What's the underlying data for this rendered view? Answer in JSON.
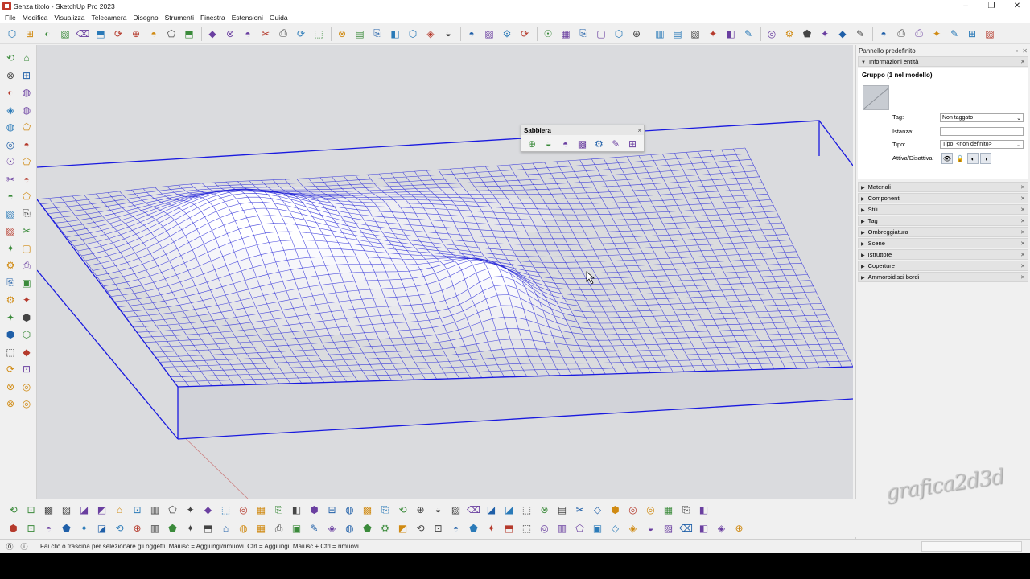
{
  "window": {
    "title": "Senza titolo - SketchUp Pro 2023",
    "controls": [
      "–",
      "❐",
      "✕"
    ]
  },
  "menu": [
    "File",
    "Modifica",
    "Visualizza",
    "Telecamera",
    "Disegno",
    "Strumenti",
    "Finestra",
    "Estensioni",
    "Guida"
  ],
  "toolbar_top_icons": [
    "new-icon",
    "open-icon",
    "save-icon",
    "cut-icon",
    "copy-icon",
    "paste-icon",
    "erase-icon",
    "undo-icon",
    "redo-icon",
    "print-icon",
    "model-info-icon",
    "xray-icon",
    "back-edges-icon",
    "wireframe-icon",
    "hidden-line-icon",
    "shaded-icon",
    "shaded-textures-icon",
    "monochrome-icon",
    "iso-view-icon",
    "top-view-icon",
    "front-view-icon",
    "right-view-icon",
    "back-view-icon",
    "left-view-icon",
    "bottom-view-icon",
    "orbit-icon",
    "pan-icon",
    "zoom-icon",
    "zoom-window-icon",
    "zoom-extents-icon",
    "previous-view-icon",
    "section-plane-icon",
    "section-cut-icon",
    "section-fill-icon",
    "display-section-icon",
    "solid-outer-shell-icon",
    "intersect-icon",
    "union-icon",
    "subtract-icon",
    "trim-icon",
    "split-icon",
    "warehouse-icon",
    "extension-warehouse-icon",
    "layout-icon",
    "styles-icon",
    "shadow-icon",
    "fog-icon",
    "match-photo-icon",
    "generate-report-icon",
    "classify-icon",
    "grid-icon",
    "location-icon",
    "terrain-icon",
    "photo-textures-icon"
  ],
  "toolbar_left_icons": [
    "select-icon",
    "lasso-icon",
    "paint-bucket-icon",
    "eraser-icon",
    "make-component-icon",
    "tag-eraser-icon",
    "line-icon",
    "freehand-icon",
    "rectangle-icon",
    "rotated-rectangle-icon",
    "circle-icon",
    "polygon-icon",
    "arc-icon",
    "two-point-arc-icon",
    "three-point-arc-icon",
    "pie-icon",
    "move-icon",
    "push-pull-icon",
    "rotate-icon",
    "follow-me-icon",
    "scale-icon",
    "offset-icon",
    "tape-measure-icon",
    "protractor-icon",
    "dimension-icon",
    "text-icon",
    "axes-icon",
    "3d-text-icon",
    "orbit-icon",
    "pan-icon",
    "zoom-icon",
    "zoom-window-icon",
    "zoom-extents-icon",
    "previous-icon",
    "position-camera-icon",
    "walk-icon",
    "look-around-icon",
    "section-plane-icon",
    "sandbox-contours-icon",
    "sandbox-scratch-icon",
    "sandbox-smoove-icon",
    "sandbox-stamp-icon"
  ],
  "sandbox": {
    "title": "Sabbiera",
    "close": "×",
    "icons": [
      "from-contours-icon",
      "from-scratch-icon",
      "smoove-icon",
      "stamp-icon",
      "drape-icon",
      "add-detail-icon",
      "flip-edge-icon"
    ]
  },
  "tray": {
    "title": "Pannello predefinito",
    "entity_panel": "Informazioni entità",
    "entity_title": "Gruppo (1 nel modello)",
    "labels": {
      "tag": "Tag:",
      "instance": "Istanza:",
      "type": "Tipo:",
      "toggle": "Attiva/Disattiva:"
    },
    "values": {
      "tag": "Non taggato",
      "instance": "",
      "type": "Tipo: <non definito>"
    },
    "panels": [
      "Materiali",
      "Componenti",
      "Stili",
      "Tag",
      "Ombreggiatura",
      "Scene",
      "Istruttore",
      "Coperture",
      "Ammorbidisci bordi"
    ]
  },
  "toolbar_bottom_row1_icons": [
    "sphere-icon",
    "globe-icon",
    "material-red-icon",
    "mask-icon",
    "solid-tools-icon",
    "egg-icon",
    "bottle-icon",
    "ear-icon",
    "shield-icon",
    "house-icon",
    "tree-icon",
    "roof-icon",
    "roof2-icon",
    "roof3-icon",
    "roof4-icon",
    "roof5-icon",
    "roof6-icon",
    "roof7-icon",
    "roof8-icon",
    "crop-icon",
    "target-icon",
    "cut-icon",
    "shape-circle-icon",
    "shape-square-icon",
    "shape-round-icon",
    "shape-pill-icon",
    "shape-oval-icon",
    "shape-ring-icon",
    "pin-icon",
    "bridge-icon",
    "gear-icon",
    "dots-icon",
    "gear2-icon",
    "grid-select-icon",
    "camera-icon",
    "plus-circle-icon",
    "cube-icon",
    "info-icon",
    "cart-icon",
    "user-icon"
  ],
  "toolbar_bottom_row2_icons": [
    "path-icon",
    "curve-icon",
    "bezier-icon",
    "spline-icon",
    "handle-icon",
    "knot-icon",
    "hook-icon",
    "leaf-icon",
    "vortex-icon",
    "loft-icon",
    "skin-icon",
    "arc-icon",
    "line-icon",
    "fillet-icon",
    "cross-icon",
    "stairs-icon",
    "wall-icon",
    "column-icon",
    "beam-icon",
    "slab-icon",
    "railing-icon",
    "window-icon",
    "door-icon",
    "fence-icon",
    "roof-icon",
    "truss-icon",
    "frame-icon",
    "panel-icon",
    "mesh-icon",
    "sculpt-icon",
    "smooth-icon",
    "plant-icon",
    "lamp-icon",
    "light-icon",
    "grid-icon",
    "align-icon",
    "measure-icon",
    "pencil-icon",
    "hammer-icon",
    "flag-icon",
    "cube-green-icon",
    "person-icon"
  ],
  "watermark": "grafica2d3d",
  "status": {
    "text": "Fai clic o trascina per selezionare gli oggetti. Maiusc = Aggiungi/rimuovi. Ctrl = Aggiungi. Maiusc + Ctrl = rimuovi.",
    "measure_label": ""
  },
  "colors": {
    "grid": "#2323d8",
    "viewport": "#dadbde",
    "accent": "#1f5fa8"
  }
}
